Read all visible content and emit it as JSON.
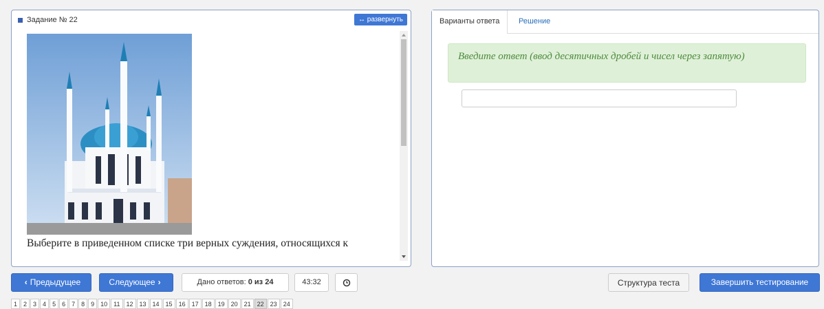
{
  "task": {
    "title": "Задание № 22",
    "expand_label": "↔ развернуть",
    "text": "Выберите в приведенном списке три верных суждения, относящихся к"
  },
  "tabs": [
    {
      "label": "Варианты ответа",
      "active": true
    },
    {
      "label": "Решение",
      "active": false
    }
  ],
  "answer": {
    "hint": "Введите ответ (ввод десятичных дробей и чисел через запятую)",
    "value": ""
  },
  "nav": {
    "prev_label": "Предыдущее",
    "next_label": "Следующее",
    "answered_label": "Дано ответов:",
    "answered_value": "0 из 24",
    "timer": "43:32",
    "structure_label": "Структура теста",
    "finish_label": "Завершить тестирование"
  },
  "pages": [
    "1",
    "2",
    "3",
    "4",
    "5",
    "6",
    "7",
    "8",
    "9",
    "10",
    "11",
    "12",
    "13",
    "14",
    "15",
    "16",
    "17",
    "18",
    "19",
    "20",
    "21",
    "22",
    "23",
    "24"
  ],
  "current_page": "22",
  "colors": {
    "accent": "#3f77d5",
    "hint_bg": "#dff0d8",
    "hint_text": "#4e8b3e"
  }
}
